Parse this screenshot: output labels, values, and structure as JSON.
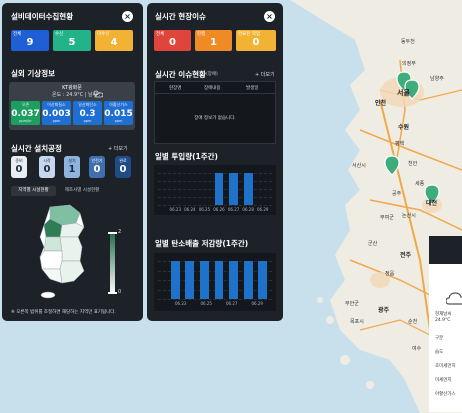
{
  "left_panel": {
    "title": "설비데이터수집현황",
    "stats": [
      {
        "label": "전체",
        "value": "9",
        "color": "#1f5fd6"
      },
      {
        "label": "수신",
        "value": "5",
        "color": "#23b38a"
      },
      {
        "label": "미수신",
        "value": "4",
        "color": "#f2b233"
      }
    ],
    "weather_title": "실외 기상정보",
    "weather": {
      "location": "KT광화문",
      "temp_text": "온도 : 24.9°C | 날씨 :",
      "icon": "cloud-sun-icon",
      "dust": [
        {
          "label": "오존",
          "value": "0.037",
          "unit": "ppm/hr",
          "color": "#1c9e5f"
        },
        {
          "label": "이산화질소",
          "value": "0.003",
          "unit": "ppm",
          "color": "#1f6fd2"
        },
        {
          "label": "일산화탄소",
          "value": "0.3",
          "unit": "ppm",
          "color": "#1f6fd2"
        },
        {
          "label": "아황산가스",
          "value": "0.015",
          "unit": "ppm",
          "color": "#1f6fd2"
        }
      ]
    },
    "process_title": "실시간 설치공정",
    "process_more": "+ 더보기",
    "process": [
      {
        "label": "준비",
        "value": "0",
        "bg": "#e9eef5",
        "fg": "#1d2a3a"
      },
      {
        "label": "시작",
        "value": "0",
        "bg": "#c6d8ef",
        "fg": "#1d2a3a"
      },
      {
        "label": "설치",
        "value": "1",
        "bg": "#8fb3df",
        "fg": "#1d2a3a"
      },
      {
        "label": "안전기",
        "value": "0",
        "bg": "#3f6fae",
        "fg": "#ffffff"
      },
      {
        "label": "완료",
        "value": "0",
        "bg": "#1f4b86",
        "fg": "#ffffff"
      }
    ],
    "tabs": [
      "지역별 시설현황",
      "제조사별 시설현황"
    ],
    "legend_max": "2",
    "legend_min": "0",
    "footnote": "※ 오른쪽 범위를 조절하면 해당하는 지역만 표기됩니다."
  },
  "mid_panel": {
    "title": "실시간 현장이슈",
    "stats": [
      {
        "label": "전체",
        "value": "0",
        "color": "#e0453c"
      },
      {
        "label": "진행",
        "value": "1",
        "color": "#f08a24"
      },
      {
        "label": "완료된 작업",
        "value": "0",
        "color": "#f2b233"
      }
    ],
    "issue_title": "실시간 이슈현황",
    "issue_sub": "(장애)",
    "issue_more": "+ 더보기",
    "table_headers": [
      "현장명",
      "장애내용",
      "발생일"
    ],
    "table_empty": "장애 정보가 없습니다.",
    "chart1_title": "일별 투입량(1주간)",
    "chart1": {
      "type": "bar",
      "categories": [
        "06.23",
        "06.24",
        "06.25",
        "06.26",
        "06.27",
        "06.28",
        "06.29"
      ],
      "values": [
        0,
        0,
        0,
        1,
        1,
        1,
        0
      ],
      "ylim": [
        0,
        1
      ]
    },
    "chart2_title": "일별 탄소배출 저감량(1주간)",
    "chart2": {
      "type": "bar",
      "categories": [
        "06.23",
        "06.25",
        "06.27",
        "06.29"
      ],
      "values": [
        1,
        1,
        1,
        1,
        1,
        1,
        1
      ],
      "ylim": [
        0,
        1
      ]
    }
  },
  "map": {
    "labels": [
      "동두천",
      "의정부",
      "인천",
      "서울",
      "남양주",
      "광주",
      "수원",
      "평택",
      "천안",
      "서산시",
      "세종",
      "공주",
      "대전",
      "논산시",
      "부여군",
      "군산",
      "전주",
      "광주",
      "순천",
      "여수",
      "목포시",
      "정읍",
      "무안군"
    ]
  },
  "right_panel": {
    "weather_text": "현재날씨",
    "temp": "24.9°C",
    "rows": [
      "구분",
      "습도",
      "초미세먼지",
      "미세먼지",
      "아황산가스"
    ]
  }
}
